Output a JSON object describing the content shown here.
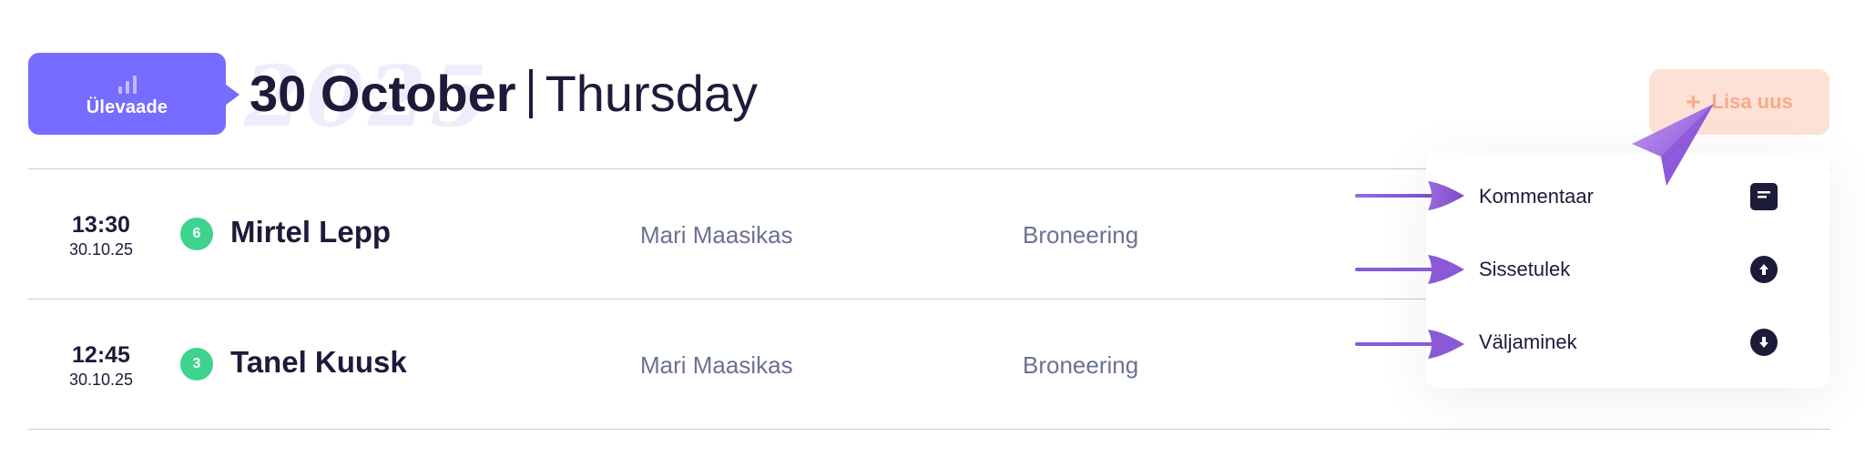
{
  "header": {
    "overview_label": "Ülevaade",
    "date_main": "30 October",
    "date_day": "Thursday",
    "year_watermark": "2025",
    "add_button_label": "Lisa uus"
  },
  "rows": [
    {
      "time": "13:30",
      "date": "30.10.25",
      "badge": "6",
      "name": "Mirtel Lepp",
      "employee": "Mari Maasikas",
      "type": "Broneering"
    },
    {
      "time": "12:45",
      "date": "30.10.25",
      "badge": "3",
      "name": "Tanel Kuusk",
      "employee": "Mari Maasikas",
      "type": "Broneering"
    }
  ],
  "menu": {
    "items": [
      {
        "label": "Kommentaar",
        "icon": "comment-icon"
      },
      {
        "label": "Sissetulek",
        "icon": "arrow-up-circle-icon"
      },
      {
        "label": "Väljaminek",
        "icon": "arrow-down-circle-icon"
      }
    ]
  },
  "colors": {
    "primary": "#766cff",
    "add_button_bg": "#fde1d6",
    "add_button_text": "#f8aa8b",
    "badge": "#3fd38d",
    "text_dark": "#1c1b3a",
    "text_muted": "#6b7194",
    "annotation": "#8a5ad6"
  }
}
